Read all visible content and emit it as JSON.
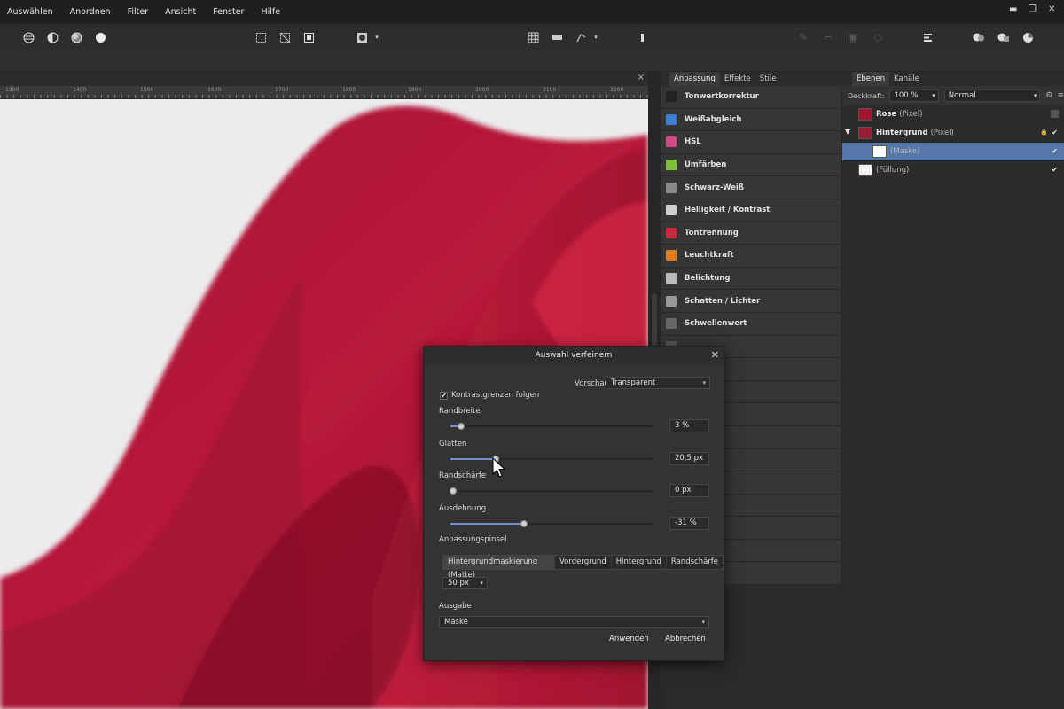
{
  "menu": [
    "Auswählen",
    "Anordnen",
    "Filter",
    "Ansicht",
    "Fenster",
    "Hilfe"
  ],
  "window_controls": [
    "▬",
    "❐",
    "✕"
  ],
  "document": {
    "close": "×",
    "ruler_ticks": [
      "1300",
      "1400",
      "1500",
      "1600",
      "1700",
      "1800",
      "1900",
      "2000",
      "2100",
      "2200"
    ]
  },
  "adjustment_panel": {
    "tabs": [
      "Anpassung",
      "Effekte",
      "Stile"
    ],
    "items": [
      {
        "label": "Tonwertkorrektur",
        "color": "#222"
      },
      {
        "label": "Weißabgleich",
        "color": "#3a7fd0"
      },
      {
        "label": "HSL",
        "color": "#d04a8a"
      },
      {
        "label": "Umfärben",
        "color": "#7bbf3a"
      },
      {
        "label": "Schwarz-Weiß",
        "color": "#888"
      },
      {
        "label": "Helligkeit / Kontrast",
        "color": "#cfcfcf"
      },
      {
        "label": "Tontrennung",
        "color": "#c8283c"
      },
      {
        "label": "Leuchtkraft",
        "color": "#e07a1e"
      },
      {
        "label": "Belichtung",
        "color": "#bbbbbb"
      },
      {
        "label": "Schatten / Lichter",
        "color": "#999"
      },
      {
        "label": "Schwellenwert",
        "color": "#666"
      },
      {
        "label": "",
        "color": "#555"
      },
      {
        "label": "",
        "color": "#555"
      },
      {
        "label": "",
        "color": "#555"
      },
      {
        "label": "",
        "color": "#555"
      },
      {
        "label": "",
        "color": "#555"
      },
      {
        "label": "",
        "color": "#555"
      },
      {
        "label": "",
        "color": "#555"
      },
      {
        "label": "",
        "color": "#555"
      },
      {
        "label": "",
        "color": "#555"
      },
      {
        "label": "",
        "color": "#555"
      },
      {
        "label": "",
        "color": "#555"
      }
    ]
  },
  "layers_panel": {
    "tabs": [
      "Ebenen",
      "Kanäle"
    ],
    "opacity_label": "Deckkraft:",
    "opacity_value": "100 %",
    "blend_mode": "Normal",
    "layers": [
      {
        "name": "Rose",
        "type": "(Pixel)",
        "thumb_color": "#a01830",
        "checked": false,
        "selected": false
      },
      {
        "name": "Hintergrund",
        "type": "(Pixel)",
        "thumb_color": "#9a1a30",
        "checked": true,
        "selected": false
      },
      {
        "name": "",
        "type": "(Maske)",
        "thumb_color": "#ffffff",
        "checked": true,
        "selected": true
      },
      {
        "name": "",
        "type": "(Füllung)",
        "thumb_color": "#f2f2f2",
        "checked": true,
        "selected": false
      }
    ],
    "check_mark": "✔",
    "expand_icon": "▼"
  },
  "dialog": {
    "title": "Auswahl verfeinern",
    "close": "✕",
    "preview_label": "Vorschau",
    "preview_value": "Transparent",
    "contrast_label": "Kontrastgrenzen folgen",
    "contrast_checked": true,
    "check_mark": "✔",
    "sliders": [
      {
        "label": "Randbreite",
        "value_text": "3 %",
        "fraction": 0.04
      },
      {
        "label": "Glätten",
        "value_text": "20,5 px",
        "fraction": 0.21
      },
      {
        "label": "Randschärfe",
        "value_text": "0 px",
        "fraction": 0.0
      },
      {
        "label": "Ausdehnung",
        "value_text": "-31 %",
        "fraction": 0.35
      }
    ],
    "brush_label": "Anpassungspinsel",
    "brush_modes": [
      "Hintergrundmaskierung (Matte)",
      "Vordergrund",
      "Hintergrund",
      "Randschärfe"
    ],
    "brush_size": "50 px",
    "output_label": "Ausgabe",
    "output_value": "Maske",
    "apply_label": "Anwenden",
    "cancel_label": "Abbrechen"
  },
  "colors": {
    "accent": "#5577aa",
    "petal": "#b8183a"
  }
}
